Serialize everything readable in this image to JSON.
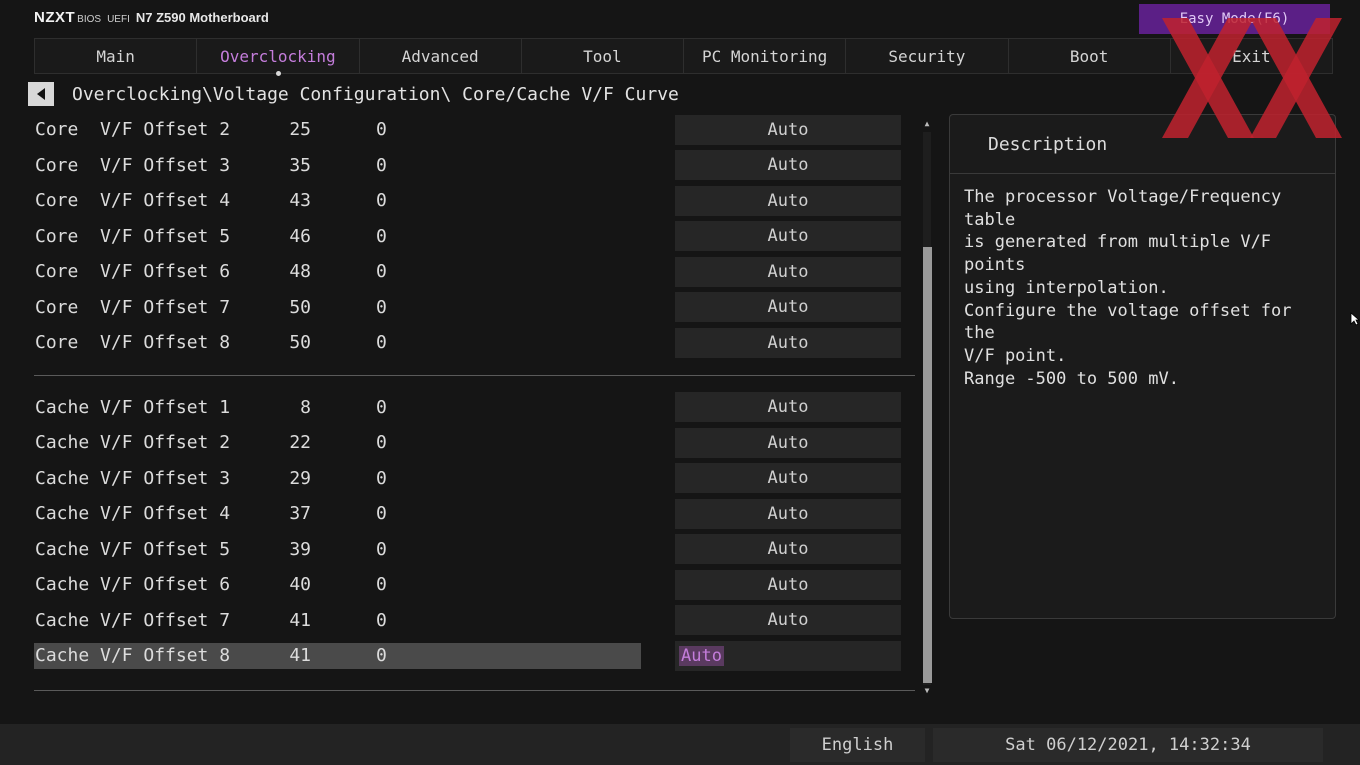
{
  "header": {
    "brand": "NZXT",
    "bios_label": "BIOS",
    "uefi_label": "UEFI",
    "model": "N7 Z590 Motherboard",
    "easy_mode": "Easy Mode(F6)"
  },
  "tabs": [
    {
      "label": "Main"
    },
    {
      "label": "Overclocking",
      "active": true
    },
    {
      "label": "Advanced"
    },
    {
      "label": "Tool"
    },
    {
      "label": "PC Monitoring"
    },
    {
      "label": "Security"
    },
    {
      "label": "Boot"
    },
    {
      "label": "Exit"
    }
  ],
  "breadcrumb": "Overclocking\\Voltage Configuration\\ Core/Cache V/F Curve",
  "core_rows": [
    {
      "name": "Core  V/F Offset 2",
      "v1": "25",
      "v2": "0",
      "value": "Auto"
    },
    {
      "name": "Core  V/F Offset 3",
      "v1": "35",
      "v2": "0",
      "value": "Auto"
    },
    {
      "name": "Core  V/F Offset 4",
      "v1": "43",
      "v2": "0",
      "value": "Auto"
    },
    {
      "name": "Core  V/F Offset 5",
      "v1": "46",
      "v2": "0",
      "value": "Auto"
    },
    {
      "name": "Core  V/F Offset 6",
      "v1": "48",
      "v2": "0",
      "value": "Auto"
    },
    {
      "name": "Core  V/F Offset 7",
      "v1": "50",
      "v2": "0",
      "value": "Auto"
    },
    {
      "name": "Core  V/F Offset 8",
      "v1": "50",
      "v2": "0",
      "value": "Auto"
    }
  ],
  "cache_rows": [
    {
      "name": "Cache V/F Offset 1",
      "v1": "8",
      "v2": "0",
      "value": "Auto"
    },
    {
      "name": "Cache V/F Offset 2",
      "v1": "22",
      "v2": "0",
      "value": "Auto"
    },
    {
      "name": "Cache V/F Offset 3",
      "v1": "29",
      "v2": "0",
      "value": "Auto"
    },
    {
      "name": "Cache V/F Offset 4",
      "v1": "37",
      "v2": "0",
      "value": "Auto"
    },
    {
      "name": "Cache V/F Offset 5",
      "v1": "39",
      "v2": "0",
      "value": "Auto"
    },
    {
      "name": "Cache V/F Offset 6",
      "v1": "40",
      "v2": "0",
      "value": "Auto"
    },
    {
      "name": "Cache V/F Offset 7",
      "v1": "41",
      "v2": "0",
      "value": "Auto"
    },
    {
      "name": "Cache V/F Offset 8",
      "v1": "41",
      "v2": "0",
      "value": "Auto",
      "selected": true
    }
  ],
  "description": {
    "title": "Description",
    "text": "The processor Voltage/Frequency table\nis generated from multiple V/F points\nusing interpolation.\nConfigure the voltage offset for the\nV/F point.\nRange -500 to 500 mV."
  },
  "footer": {
    "language": "English",
    "datetime": "Sat 06/12/2021, 14:32:34"
  },
  "colors": {
    "accent": "#c47ddb",
    "easy_mode_bg": "#5b1f86",
    "watermark": "#c0222e"
  },
  "icons": {
    "back": "back-arrow-icon",
    "scroll_up": "scroll-up-icon",
    "scroll_down": "scroll-down-icon",
    "watermark": "xx-watermark-icon",
    "cursor": "mouse-cursor-icon"
  }
}
